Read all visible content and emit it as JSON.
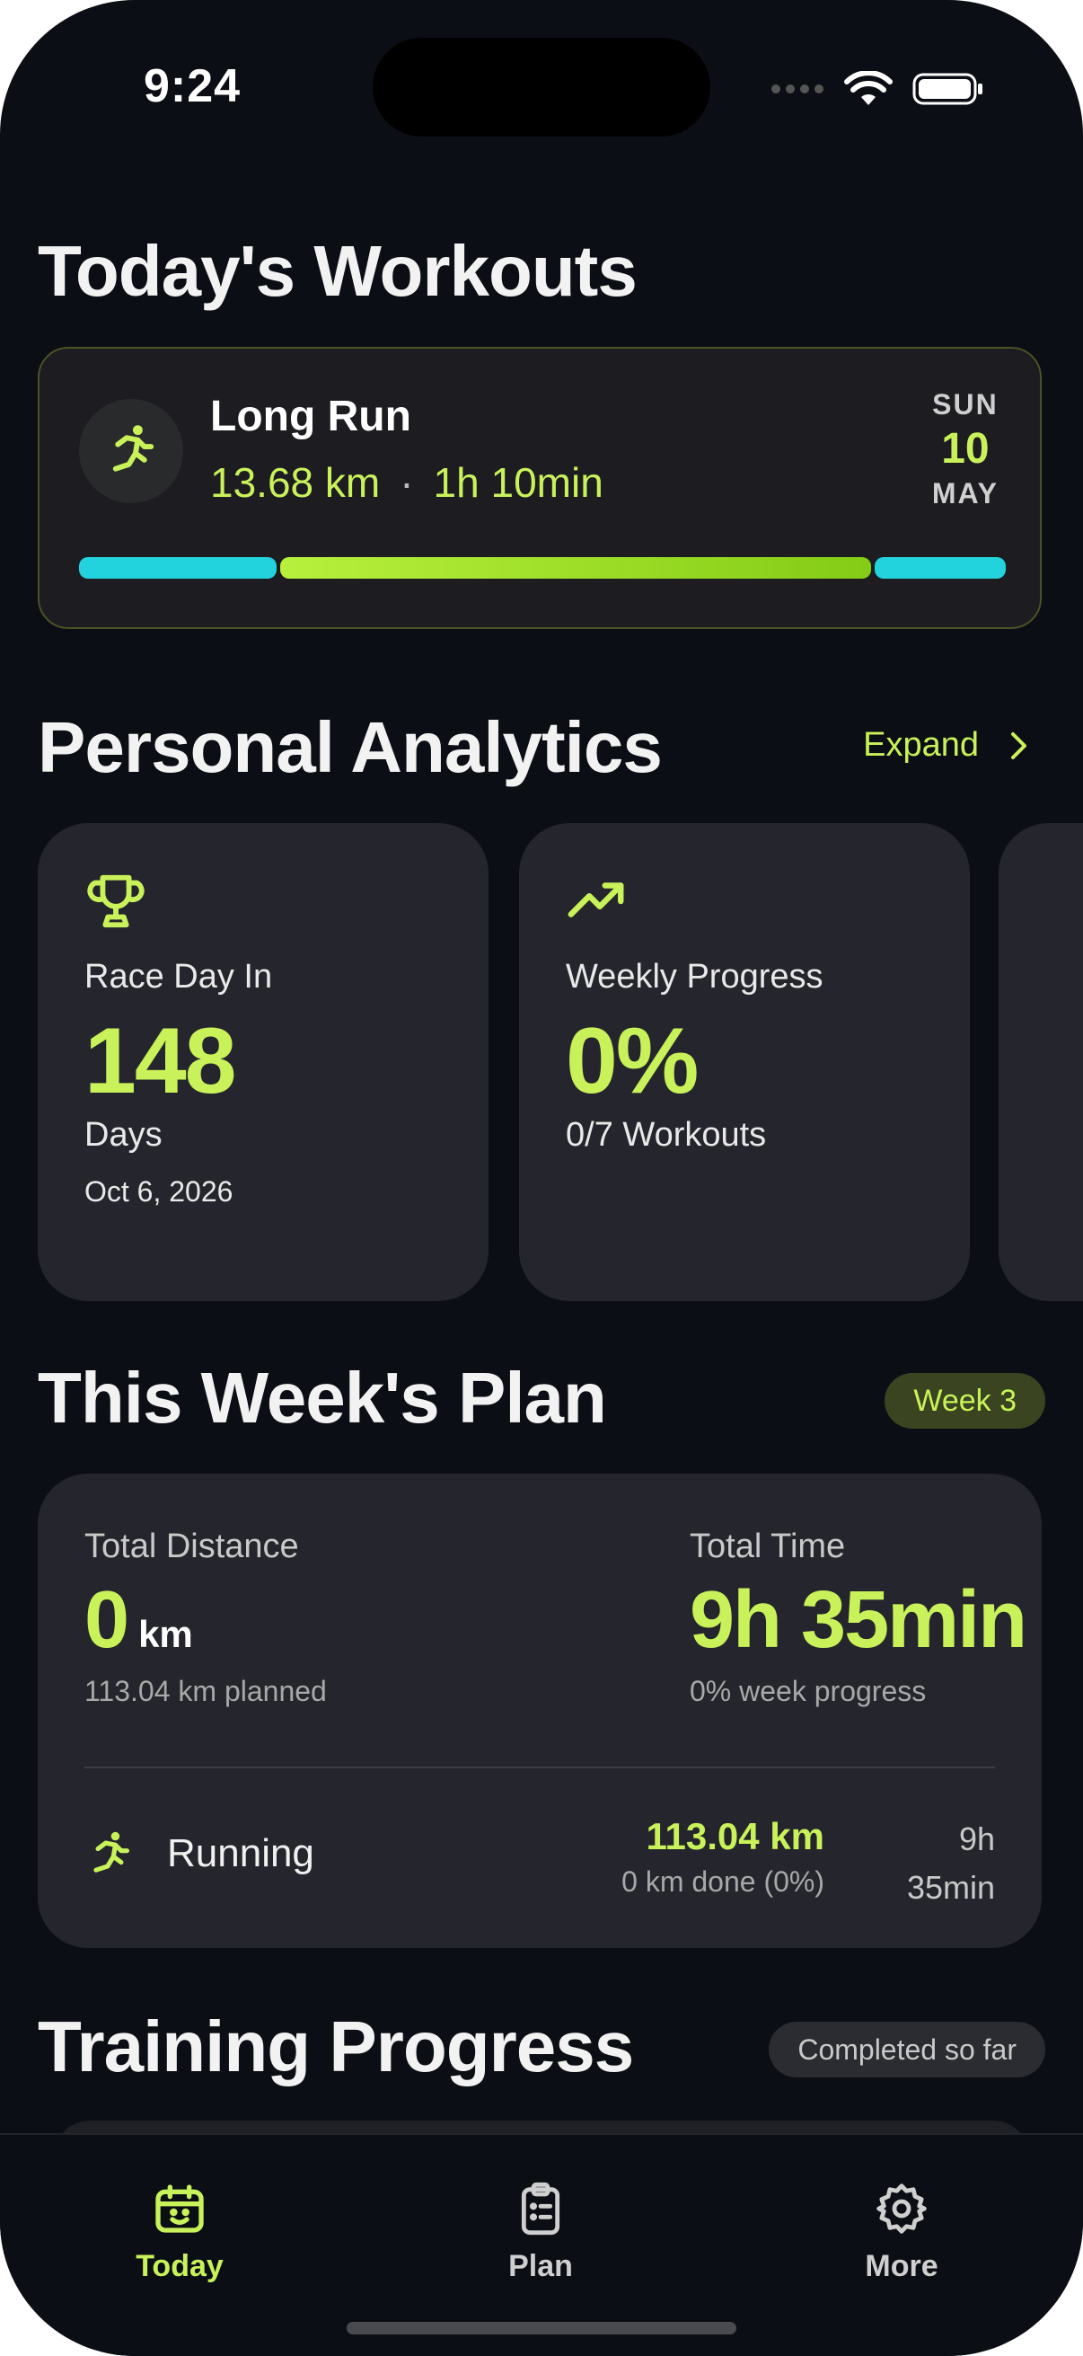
{
  "status_bar": {
    "time": "9:24"
  },
  "todays_workouts": {
    "title": "Today's Workouts",
    "card": {
      "name": "Long Run",
      "distance": "13.68 km",
      "separator": "·",
      "duration": "1h 10min",
      "date": {
        "dow": "SUN",
        "day": "10",
        "month": "MAY"
      },
      "icon": "running-icon",
      "colors": {
        "warmup": "#22d3de",
        "main": "#a3e635",
        "cooldown": "#22d3de"
      }
    }
  },
  "analytics": {
    "title": "Personal Analytics",
    "expand_label": "Expand",
    "cards": [
      {
        "icon": "trophy-icon",
        "label": "Race Day In",
        "value": "148",
        "sub": "Days",
        "sub2": "Oct 6, 2026"
      },
      {
        "icon": "trend-up-icon",
        "label": "Weekly Progress",
        "value": "0%",
        "sub": "0/7 Workouts"
      }
    ]
  },
  "week_plan": {
    "title": "This Week's Plan",
    "week_badge": "Week 3",
    "total_distance_label": "Total Distance",
    "total_distance_value": "0",
    "total_distance_unit": "km",
    "total_distance_planned": "113.04 km planned",
    "total_time_label": "Total Time",
    "total_time_value": "9h 35min",
    "total_time_progress": "0% week progress",
    "activity": {
      "icon": "running-icon",
      "label": "Running",
      "km": "113.04 km",
      "done": "0 km done (0%)",
      "time_line1": "9h",
      "time_line2": "35min"
    }
  },
  "training_progress": {
    "title": "Training Progress",
    "badge": "Completed so far"
  },
  "tabbar": {
    "tabs": [
      {
        "label": "Today",
        "icon": "calendar-icon",
        "active": true
      },
      {
        "label": "Plan",
        "icon": "clipboard-icon",
        "active": false
      },
      {
        "label": "More",
        "icon": "gear-icon",
        "active": false
      }
    ]
  },
  "colors": {
    "accent": "#c9f25a",
    "background": "#0c0e15",
    "card": "#25262d"
  }
}
